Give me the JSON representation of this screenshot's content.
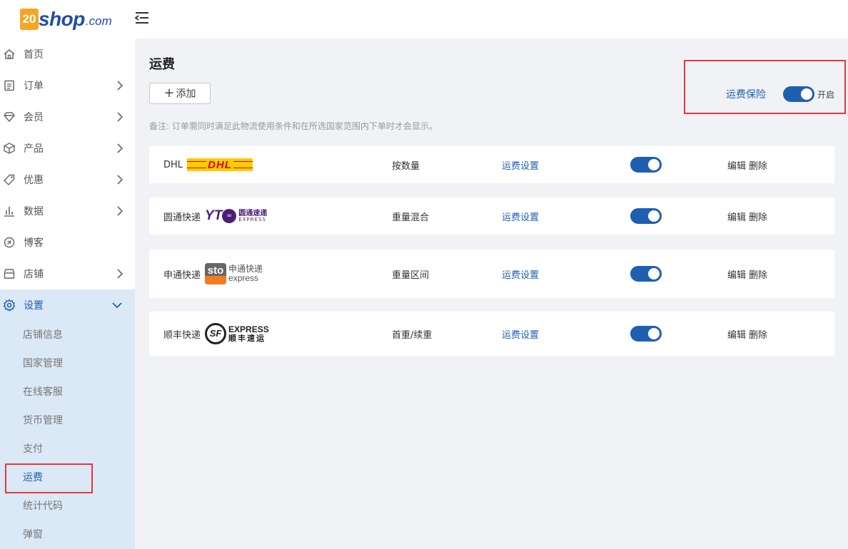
{
  "brand": {
    "badge": "20",
    "name": "shop",
    "suffix": ".com"
  },
  "sidebar": {
    "items": [
      {
        "label": "首页",
        "icon": "home-icon"
      },
      {
        "label": "订单",
        "icon": "order-icon"
      },
      {
        "label": "会员",
        "icon": "member-icon"
      },
      {
        "label": "产品",
        "icon": "product-icon"
      },
      {
        "label": "优惠",
        "icon": "tag-icon"
      },
      {
        "label": "数据",
        "icon": "chart-icon"
      },
      {
        "label": "博客",
        "icon": "blog-icon"
      },
      {
        "label": "店铺",
        "icon": "store-icon"
      },
      {
        "label": "设置",
        "icon": "gear-icon"
      }
    ],
    "settings_sub": [
      "店铺信息",
      "国家管理",
      "在线客服",
      "货币管理",
      "支付",
      "运费",
      "统计代码",
      "弹窗"
    ]
  },
  "main": {
    "title": "运费",
    "add_label": "添加",
    "note": "备注: 订单需同时满足此物流使用条件和在所选国家范围内下单时才会显示。",
    "insurance": {
      "label": "运费保险",
      "state": "开启"
    },
    "carriers": [
      {
        "name": "DHL",
        "logo_text": "DHL",
        "type": "按数量",
        "link": "运费设置",
        "edit": "编辑",
        "delete": "删除"
      },
      {
        "name": "圆通快递",
        "logo_text": "YT",
        "logo_sub": "圆通速递",
        "logo_en": "EXPRESS",
        "type": "重量混合",
        "link": "运费设置",
        "edit": "编辑",
        "delete": "删除"
      },
      {
        "name": "申通快递",
        "logo_text": "sto",
        "logo_sub": "申通快递",
        "logo_en": "express",
        "type": "重量区间",
        "link": "运费设置",
        "edit": "编辑",
        "delete": "删除"
      },
      {
        "name": "顺丰快递",
        "logo_text": "SF",
        "logo_sub": "顺丰速运",
        "logo_en": "EXPRESS",
        "type": "首重/续重",
        "link": "运费设置",
        "edit": "编辑",
        "delete": "删除"
      }
    ]
  },
  "colors": {
    "accent": "#1f5fb0",
    "highlight": "#e5383b",
    "sidebar_active": "#dbe8f6"
  }
}
